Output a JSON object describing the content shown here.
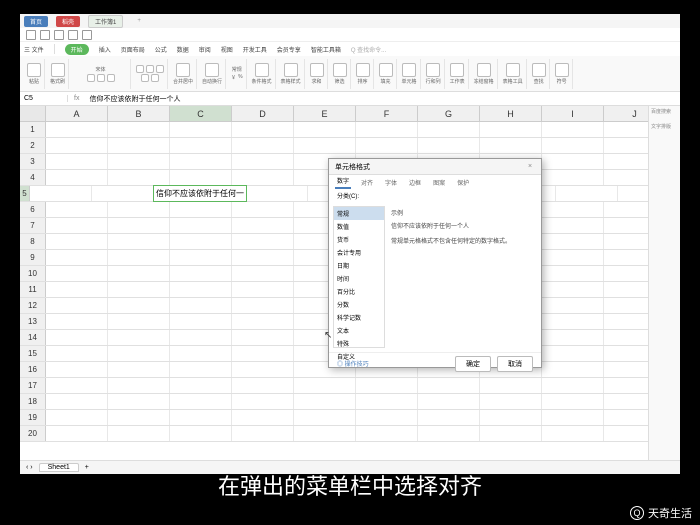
{
  "titlebar": {
    "tab1": "首页",
    "tab2": "稻壳",
    "tab3": "工作簿1",
    "plus": "+"
  },
  "ribbonTabs": {
    "menu": "三 文件",
    "start": "开始",
    "insert": "插入",
    "layout": "页面布局",
    "formula": "公式",
    "data": "数据",
    "review": "审阅",
    "view": "视图",
    "tools": "开发工具",
    "member": "会员专享",
    "smart": "智能工具箱",
    "search": "Q 查找命令..."
  },
  "ribbonLabels": {
    "paste": "粘贴",
    "format": "格式刷",
    "font": "宋体",
    "merge": "合并居中",
    "wrap": "自动换行",
    "general": "常规",
    "money": "￥",
    "percent": "%",
    "cond": "条件格式",
    "style": "表格样式",
    "sum": "求和",
    "filter": "筛选",
    "sort": "排序",
    "fill": "填充",
    "cell": "单元格",
    "row": "行和列",
    "sheet": "工作表",
    "freeze": "冻结窗格",
    "tbstyle": "表格工具",
    "find": "查找",
    "symbol": "符号"
  },
  "formula": {
    "cellRef": "C5",
    "text": "信仰不应该依附于任何一个人"
  },
  "columns": [
    "A",
    "B",
    "C",
    "D",
    "E",
    "F",
    "G",
    "H",
    "I",
    "J"
  ],
  "rows": [
    1,
    2,
    3,
    4,
    5,
    6,
    7,
    8,
    9,
    10,
    11,
    12,
    13,
    14,
    15,
    16,
    17,
    18,
    19,
    20
  ],
  "cellContent": "信仰不应该依附于任何一",
  "sheet": {
    "name": "Sheet1",
    "add": "+"
  },
  "rightPanel": {
    "t1": "百度搜索",
    "t2": "文字排版"
  },
  "dialog": {
    "title": "单元格格式",
    "tabs": [
      "数字",
      "对齐",
      "字体",
      "边框",
      "图案",
      "保护"
    ],
    "catHeader": "分类(C):",
    "categories": [
      "常规",
      "数值",
      "货币",
      "会计专用",
      "日期",
      "时间",
      "百分比",
      "分数",
      "科学记数",
      "文本",
      "特殊",
      "自定义"
    ],
    "sampleLabel": "示例",
    "sampleText": "信仰不应该依附于任何一个人",
    "desc": "常规单元格格式不包含任何特定的数字格式。",
    "tip": "◎ 操作技巧",
    "ok": "确定",
    "cancel": "取消"
  },
  "subtitle": "在弹出的菜单栏中选择对齐",
  "watermark": "天奇生活"
}
